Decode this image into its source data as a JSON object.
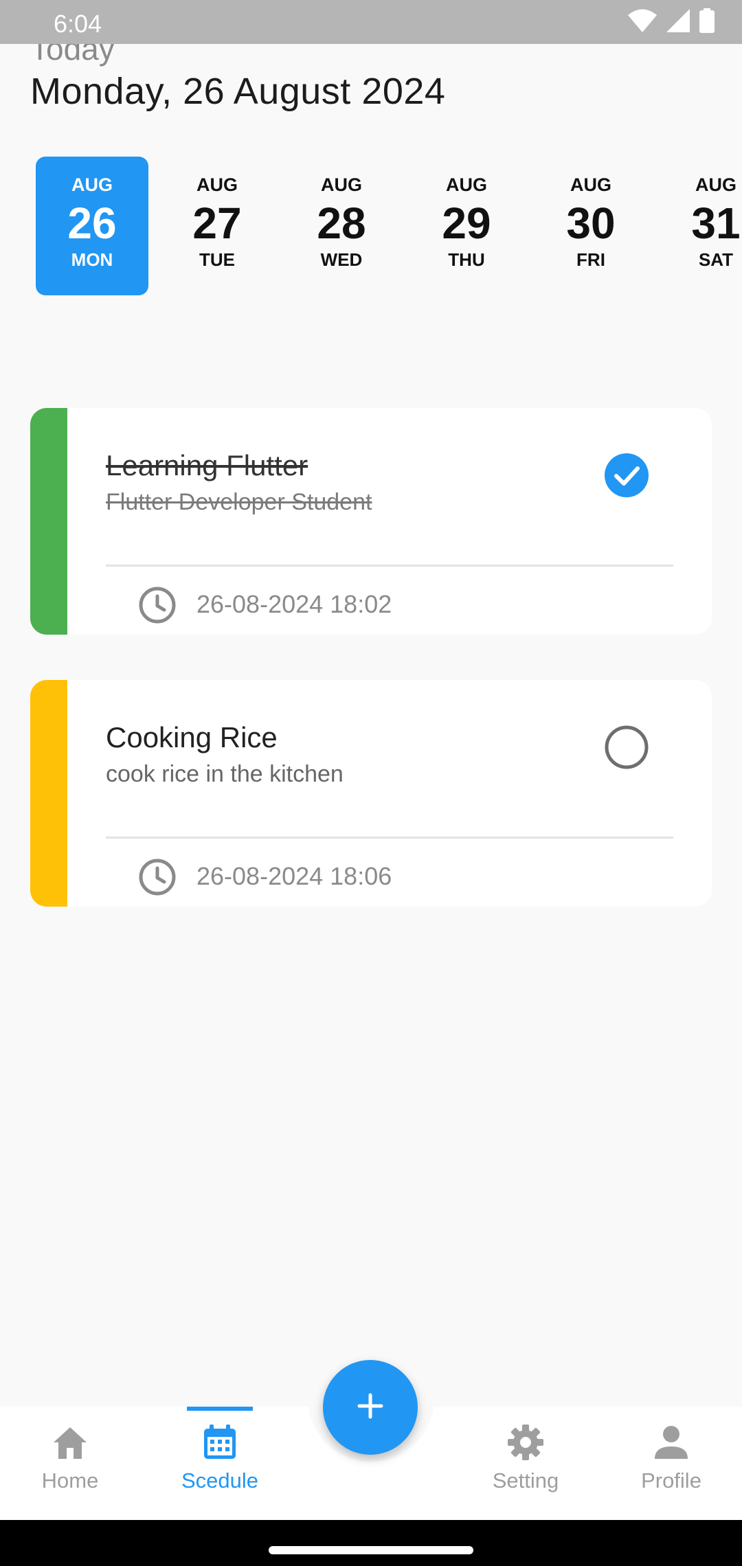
{
  "status_bar": {
    "time": "6:04",
    "icons": [
      "wifi-icon",
      "signal-icon",
      "battery-icon"
    ]
  },
  "header": {
    "today_label": "Today",
    "date": "Monday, 26 August 2024"
  },
  "date_strip": [
    {
      "month": "AUG",
      "day": "26",
      "weekday": "MON",
      "selected": true
    },
    {
      "month": "AUG",
      "day": "27",
      "weekday": "TUE",
      "selected": false
    },
    {
      "month": "AUG",
      "day": "28",
      "weekday": "WED",
      "selected": false
    },
    {
      "month": "AUG",
      "day": "29",
      "weekday": "THU",
      "selected": false
    },
    {
      "month": "AUG",
      "day": "30",
      "weekday": "FRI",
      "selected": false
    },
    {
      "month": "AUG",
      "day": "31",
      "weekday": "SAT",
      "selected": false
    }
  ],
  "tasks": [
    {
      "title": "Learning Flutter",
      "description": "Flutter Developer Student",
      "datetime": "26-08-2024 18:02",
      "completed": true,
      "color": "#4caf50"
    },
    {
      "title": "Cooking Rice",
      "description": "cook rice in the kitchen",
      "datetime": "26-08-2024 18:06",
      "completed": false,
      "color": "#ffc107"
    }
  ],
  "fab": {
    "icon": "plus-icon"
  },
  "bottom_nav": [
    {
      "label": "Home",
      "icon": "home-icon",
      "active": false
    },
    {
      "label": "Scedule",
      "icon": "calendar-icon",
      "active": true
    },
    {
      "label": "Setting",
      "icon": "gear-icon",
      "active": false
    },
    {
      "label": "Profile",
      "icon": "person-icon",
      "active": false
    }
  ],
  "colors": {
    "accent": "#2196f3",
    "background": "#f9f9f9"
  }
}
